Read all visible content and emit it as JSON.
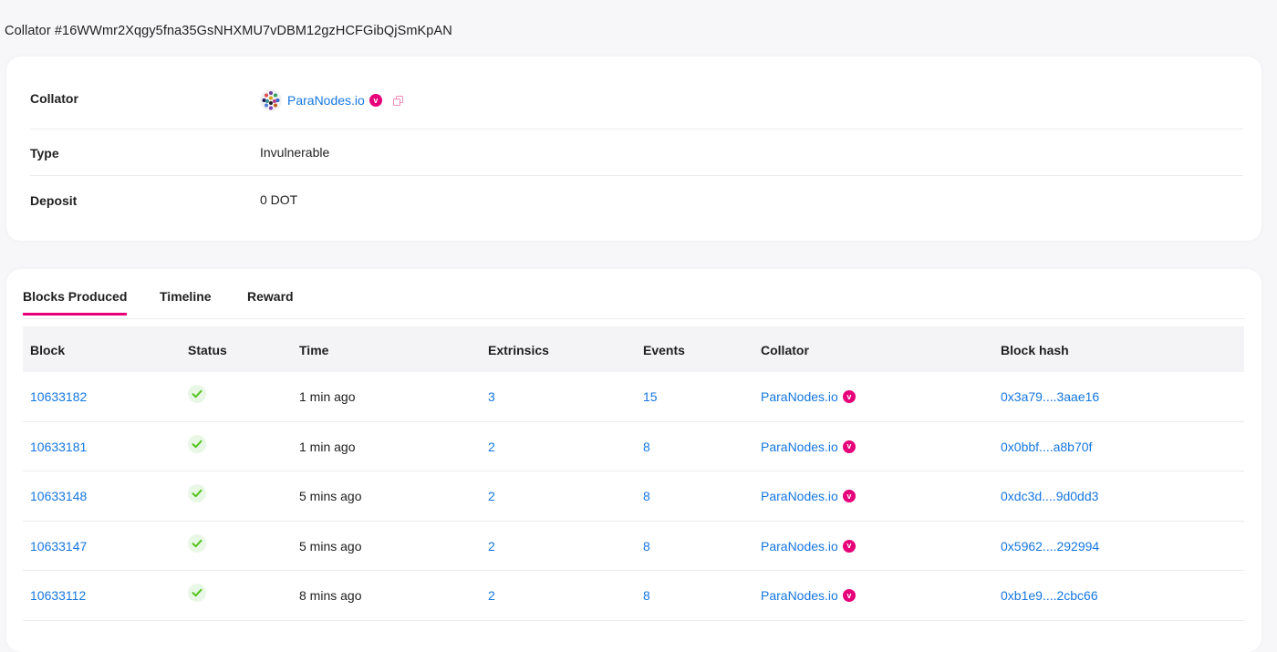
{
  "page": {
    "title": "Collator #16WWmr2Xqgy5fna35GsNHXMU7vDBM12gzHCFGibQjSmKpAN"
  },
  "info": {
    "collator_label": "Collator",
    "collator_name": "ParaNodes.io",
    "verified_badge": "v",
    "type_label": "Type",
    "type_value": "Invulnerable",
    "deposit_label": "Deposit",
    "deposit_value": "0 DOT"
  },
  "tabs": [
    {
      "label": "Blocks Produced",
      "active": true
    },
    {
      "label": "Timeline",
      "active": false
    },
    {
      "label": "Reward",
      "active": false
    }
  ],
  "table": {
    "headers": {
      "block": "Block",
      "status": "Status",
      "time": "Time",
      "extrinsics": "Extrinsics",
      "events": "Events",
      "collator": "Collator",
      "hash": "Block hash"
    },
    "rows": [
      {
        "block": "10633182",
        "status": "success",
        "time": "1 min ago",
        "extrinsics": "3",
        "events": "15",
        "collator": "ParaNodes.io",
        "hash": "0x3a79....3aae16"
      },
      {
        "block": "10633181",
        "status": "success",
        "time": "1 min ago",
        "extrinsics": "2",
        "events": "8",
        "collator": "ParaNodes.io",
        "hash": "0x0bbf....a8b70f"
      },
      {
        "block": "10633148",
        "status": "success",
        "time": "5 mins ago",
        "extrinsics": "2",
        "events": "8",
        "collator": "ParaNodes.io",
        "hash": "0xdc3d....9d0dd3"
      },
      {
        "block": "10633147",
        "status": "success",
        "time": "5 mins ago",
        "extrinsics": "2",
        "events": "8",
        "collator": "ParaNodes.io",
        "hash": "0x5962....292994"
      },
      {
        "block": "10633112",
        "status": "success",
        "time": "8 mins ago",
        "extrinsics": "2",
        "events": "8",
        "collator": "ParaNodes.io",
        "hash": "0xb1e9....2cbc66"
      }
    ]
  },
  "icons": {
    "avatar": "paranodes-avatar-icon",
    "verified": "verified-badge-icon",
    "copy": "copy-icon",
    "status": "check-icon"
  },
  "colors": {
    "accent": "#e6007a",
    "link": "#1677e0",
    "success": "#52c41a"
  }
}
